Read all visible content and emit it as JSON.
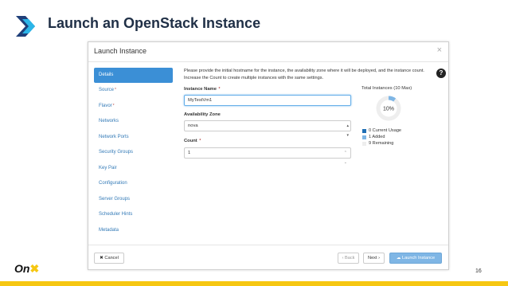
{
  "slide": {
    "title": "Launch an OpenStack Instance",
    "page_number": "16",
    "footer_logo": "On"
  },
  "modal": {
    "title": "Launch Instance",
    "close_glyph": "×",
    "help_text": "Please provide the initial hostname for the instance, the availability zone where it will be deployed, and the instance count. Increase the Count to create multiple instances with the same settings.",
    "help_glyph": "?",
    "sidebar": [
      {
        "label": "Details",
        "required": false,
        "active": true
      },
      {
        "label": "Source",
        "required": true,
        "active": false
      },
      {
        "label": "Flavor",
        "required": true,
        "active": false
      },
      {
        "label": "Networks",
        "required": false,
        "active": false
      },
      {
        "label": "Network Ports",
        "required": false,
        "active": false
      },
      {
        "label": "Security Groups",
        "required": false,
        "active": false
      },
      {
        "label": "Key Pair",
        "required": false,
        "active": false
      },
      {
        "label": "Configuration",
        "required": false,
        "active": false
      },
      {
        "label": "Server Groups",
        "required": false,
        "active": false
      },
      {
        "label": "Scheduler Hints",
        "required": false,
        "active": false
      },
      {
        "label": "Metadata",
        "required": false,
        "active": false
      }
    ],
    "fields": {
      "instance_name": {
        "label": "Instance Name",
        "required_mark": "*",
        "value": "MyTestVm1"
      },
      "availability_zone": {
        "label": "Availability Zone",
        "value": "nova"
      },
      "count": {
        "label": "Count",
        "required_mark": "*",
        "value": "1"
      }
    },
    "instances": {
      "title": "Total Instances (10 Max)",
      "percent_label": "10%",
      "percent": 10,
      "legend": [
        {
          "label": "0 Current Usage",
          "color": "#1f6fb5"
        },
        {
          "label": "1 Added",
          "color": "#7fb6e5"
        },
        {
          "label": "9 Remaining",
          "color": "#eeeeee"
        }
      ]
    },
    "footer": {
      "cancel": "✖ Cancel",
      "back": "‹ Back",
      "next": "Next ›",
      "launch": "☁ Launch Instance"
    }
  },
  "colors": {
    "accent": "#3b8fd6",
    "brand_yellow": "#f6c712"
  }
}
